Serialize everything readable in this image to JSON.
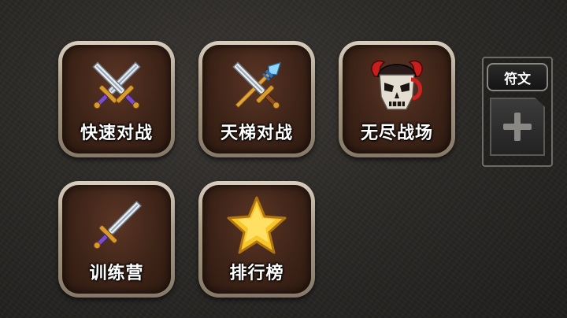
{
  "menu": {
    "tiles": [
      {
        "label": "快速对战",
        "icon": "crossed-swords-icon"
      },
      {
        "label": "天梯对战",
        "icon": "sword-and-spear-icon"
      },
      {
        "label": "无尽战场",
        "icon": "demon-skull-helmet-icon"
      },
      {
        "label": "训练营",
        "icon": "sword-icon"
      },
      {
        "label": "排行榜",
        "icon": "star-icon"
      }
    ]
  },
  "rune_panel": {
    "tab_label": "符文",
    "slot_icon": "plus-icon"
  },
  "colors": {
    "tile_frame": "#a89b86",
    "tile_inner": "#3e2418",
    "background": "#2c2a27",
    "label_text": "#ffffff"
  }
}
